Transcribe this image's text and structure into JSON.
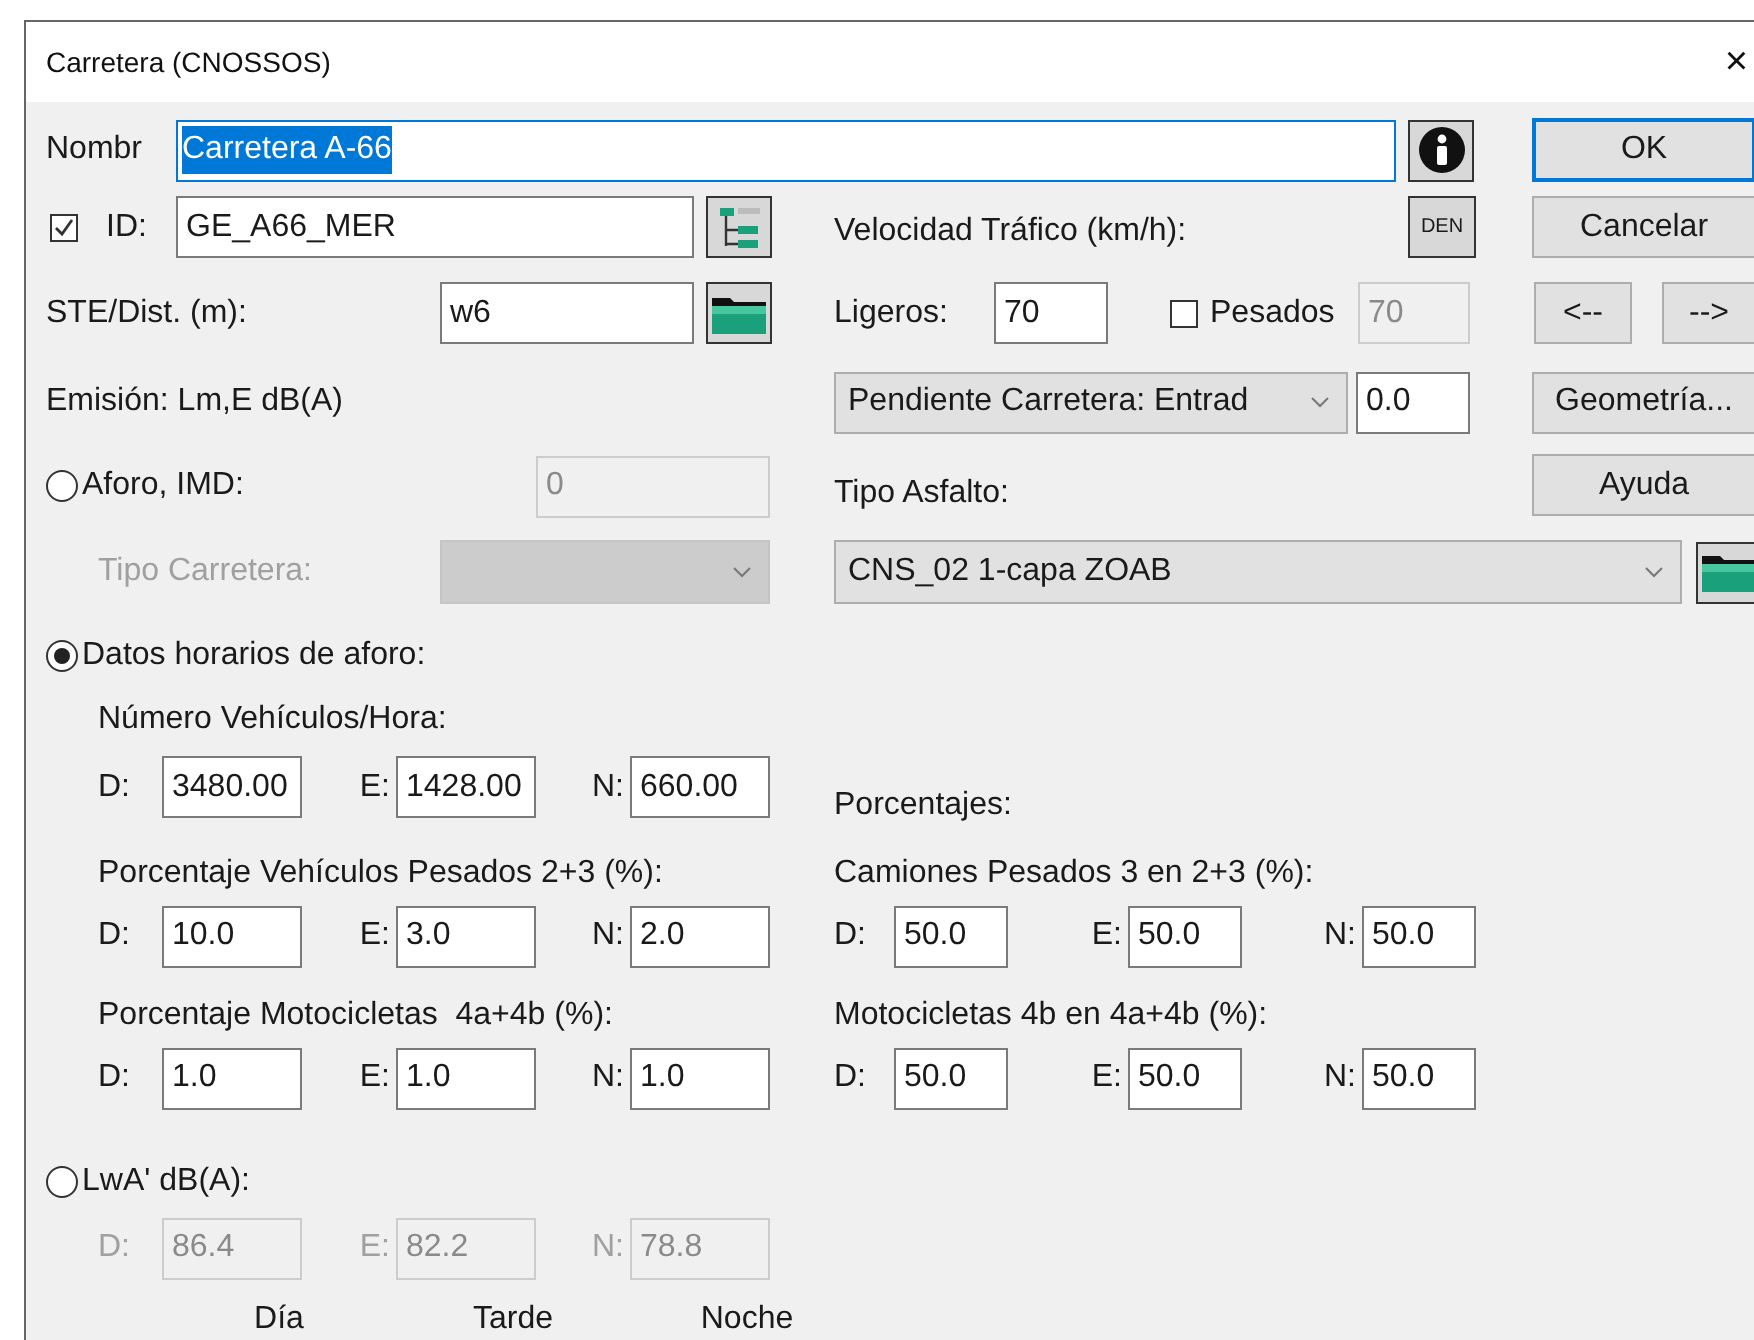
{
  "window": {
    "title": "Carretera (CNOSSOS)",
    "close": "×"
  },
  "name": {
    "label": "Nombr",
    "value": "Carretera A-66",
    "selected": true
  },
  "id": {
    "checked": true,
    "label": "ID:",
    "value": "GE_A66_MER"
  },
  "ste": {
    "label": "STE/Dist. (m):",
    "value": "w6"
  },
  "emision_label": "Emisión: Lm,E dB(A)",
  "aforo": {
    "selected": false,
    "label": "Aforo, IMD:",
    "value": "0",
    "disabled": true
  },
  "tipo_carretera": {
    "label": "Tipo Carretera:",
    "disabled": true
  },
  "velocidad": {
    "label": "Velocidad Tráfico (km/h):",
    "den_button": "DEN",
    "ligeros_label": "Ligeros:",
    "ligeros": "70",
    "pesados": {
      "checked": false,
      "label": "Pesados",
      "value": "70",
      "disabled": true
    }
  },
  "pendiente": {
    "option": "Pendiente Carretera: Entrad",
    "value": "0.0"
  },
  "tipo_asfalto": {
    "label": "Tipo Asfalto:",
    "value": "CNS_02 1-capa ZOAB"
  },
  "buttons": [
    {
      "label": "OK",
      "focused": true
    },
    {
      "label": "Cancelar",
      "focused": false
    },
    {
      "label": "<--",
      "focused": false
    },
    {
      "label": "-->",
      "focused": false
    },
    {
      "label": "Geometría...",
      "focused": false
    },
    {
      "label": "Ayuda",
      "focused": false
    }
  ],
  "datos_horarios": {
    "selected": true,
    "label": "Datos horarios de aforo:",
    "vehiculos": {
      "label": "Número Vehículos/Hora:",
      "fields": [
        {
          "label": "D:",
          "value": "3480.00"
        },
        {
          "label": "E:",
          "value": "1428.00"
        },
        {
          "label": "N:",
          "value": "660.00"
        }
      ]
    },
    "pesados": {
      "label": "Porcentaje Vehículos Pesados 2+3 (%):",
      "fields": [
        {
          "label": "D:",
          "value": "10.0"
        },
        {
          "label": "E:",
          "value": "3.0"
        },
        {
          "label": "N:",
          "value": "2.0"
        }
      ]
    },
    "motos": {
      "label": "Porcentaje Motocicletas  4a+4b (%):",
      "fields": [
        {
          "label": "D:",
          "value": "1.0"
        },
        {
          "label": "E:",
          "value": "1.0"
        },
        {
          "label": "N:",
          "value": "1.0"
        }
      ]
    }
  },
  "porcentajes": {
    "label": "Porcentajes:",
    "camiones": {
      "label": "Camiones Pesados 3 en 2+3 (%):",
      "fields": [
        {
          "label": "D:",
          "value": "50.0"
        },
        {
          "label": "E:",
          "value": "50.0"
        },
        {
          "label": "N:",
          "value": "50.0"
        }
      ]
    },
    "motos4b": {
      "label": "Motocicletas 4b en 4a+4b (%):",
      "fields": [
        {
          "label": "D:",
          "value": "50.0"
        },
        {
          "label": "E:",
          "value": "50.0"
        },
        {
          "label": "N:",
          "value": "50.0"
        }
      ]
    }
  },
  "lwa": {
    "selected": false,
    "label": "LwA' dB(A):",
    "disabled": true,
    "fields": [
      {
        "label": "D:",
        "value": "86.4"
      },
      {
        "label": "E:",
        "value": "82.2"
      },
      {
        "label": "N:",
        "value": "78.8"
      }
    ],
    "period_labels": [
      "Día",
      "Tarde",
      "Noche"
    ]
  }
}
